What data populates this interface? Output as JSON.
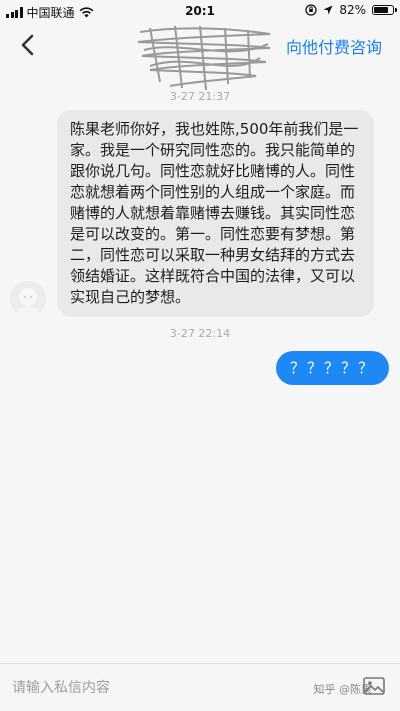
{
  "status_bar": {
    "carrier": "中国联通",
    "time": "20:1",
    "battery_percent": "82%",
    "battery_level": 0.82
  },
  "nav": {
    "back_icon": "chevron-left-icon",
    "action_label": "向他付费咨询"
  },
  "conversation": {
    "messages": [
      {
        "timestamp": "3-27 21:37",
        "sender": "other",
        "text": "陈果老师你好，我也姓陈,500年前我们是一家。我是一个研究同性恋的。我只能简单的跟你说几句。同性恋就好比赌博的人。同性恋就想着两个同性别的人组成一个家庭。而赌博的人就想着靠赌博去赚钱。其实同性恋是可以改变的。第一。同性恋要有梦想。第二，同性恋可以采取一种男女结拜的方式去领结婚证。这样既符合中国的法律，又可以实现自己的梦想。"
      },
      {
        "timestamp": "3-27 22:14",
        "sender": "self",
        "text": "？？？？？"
      }
    ]
  },
  "input": {
    "placeholder": "请输入私信内容",
    "value": ""
  },
  "watermark": "知乎 @陈果",
  "colors": {
    "accent": "#1e88f5",
    "incoming_bubble": "#e9e9e9",
    "background": "#f6f6f6"
  }
}
